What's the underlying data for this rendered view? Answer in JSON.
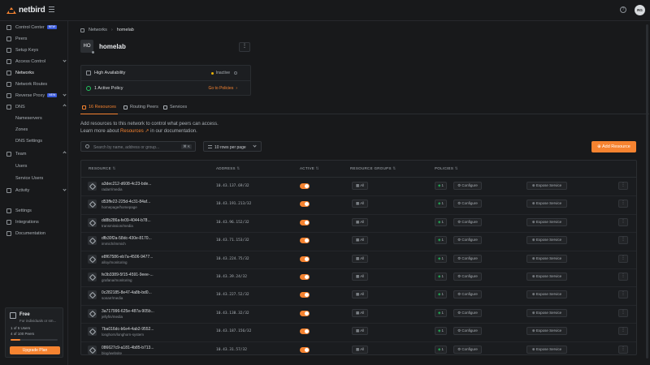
{
  "app": {
    "name": "netbird",
    "user_initials": "RG"
  },
  "sidebar": {
    "items": [
      {
        "label": "Control Center",
        "badge": "NEW",
        "icon": "grid-icon"
      },
      {
        "label": "Peers",
        "icon": "monitor-icon"
      },
      {
        "label": "Setup Keys",
        "icon": "key-icon"
      },
      {
        "label": "Access Control",
        "icon": "shield-icon"
      },
      {
        "label": "Networks",
        "icon": "network-icon"
      },
      {
        "label": "Network Routes",
        "icon": "route-icon"
      },
      {
        "label": "Reverse Proxy",
        "badge": "NEW",
        "icon": "proxy-icon"
      },
      {
        "label": "DNS",
        "icon": "globe-icon"
      },
      {
        "label": "Nameservers",
        "icon": ""
      },
      {
        "label": "Zones",
        "icon": ""
      },
      {
        "label": "DNS Settings",
        "icon": ""
      },
      {
        "label": "Team",
        "icon": "users-icon"
      },
      {
        "label": "Users",
        "icon": ""
      },
      {
        "label": "Service Users",
        "icon": ""
      },
      {
        "label": "Activity",
        "icon": "activity-icon"
      },
      {
        "label": "Settings",
        "icon": "gear-icon"
      },
      {
        "label": "Integrations",
        "icon": "puzzle-icon"
      },
      {
        "label": "Documentation",
        "icon": "book-icon"
      }
    ],
    "plan": {
      "title": "Free",
      "subtitle": "For individuals or sm...",
      "users": "1 of 5 Users",
      "peers": "4 of 100 Peers",
      "upgrade_label": "Upgrade Plan",
      "usage_fraction": 0.2
    }
  },
  "breadcrumb": {
    "root": "Networks",
    "current": "homelab"
  },
  "network": {
    "initials": "HO",
    "name": "homelab"
  },
  "info": {
    "ha_label": "High Availability",
    "ha_status": "Inactive",
    "policy_label": "1 Active Policy",
    "policy_link": "Go to Policies"
  },
  "tabs": [
    {
      "label": "16 Resources"
    },
    {
      "label": "Routing Peers"
    },
    {
      "label": "Services"
    }
  ],
  "description": {
    "line1": "Add resources to this network to control what peers can access.",
    "line2_pre": "Learn more about",
    "line2_link": "Resources",
    "line2_post": "in our documentation."
  },
  "toolbar": {
    "search_placeholder": "Search by name, address or group...",
    "search_shortcut": "⌘ K",
    "rows_per_page": "10 rows per page",
    "add_label": "Add Resource"
  },
  "table": {
    "headers": {
      "resource": "RESOURCE",
      "address": "ADDRESS",
      "active": "ACTIVE",
      "groups": "RESOURCE GROUPS",
      "policies": "POLICIES"
    },
    "group_label": "All",
    "configure_label": "Configure",
    "expose_label": "Expose Service",
    "rows": [
      {
        "id": "a3dec212-d608-4c23-bde...",
        "name": "radarr/media",
        "address": "10.43.137.69/32",
        "policies": "1"
      },
      {
        "id": "d53ffe22-225d-4c31-84af...",
        "name": "homepage/homepage",
        "address": "10.43.191.213/32",
        "policies": "1"
      },
      {
        "id": "dd8b286a-fe09-4044-b78...",
        "name": "transmission/media",
        "address": "10.43.96.152/32",
        "policies": "1"
      },
      {
        "id": "dfb30f2a-58dc-430e-8170...",
        "name": "immich/immich",
        "address": "10.43.71.153/32",
        "policies": "1"
      },
      {
        "id": "e8f67586-eb7a-4506-9477...",
        "name": "alloy/monitoring",
        "address": "10.43.224.75/32",
        "policies": "1"
      },
      {
        "id": "fe3b3389-5f15-4591-9eee-...",
        "name": "grafana/monitoring",
        "address": "10.43.39.24/32",
        "policies": "1"
      },
      {
        "id": "0c282185-8e47-4a8b-bd0...",
        "name": "sonarr/media",
        "address": "10.43.227.52/32",
        "policies": "1"
      },
      {
        "id": "3a717996-625e-487a-905b...",
        "name": "jellyfin/media",
        "address": "10.43.138.32/32",
        "policies": "1"
      },
      {
        "id": "7ba016dc-b6e4-4ab2-9552...",
        "name": "longhorn/longhorn-system",
        "address": "10.43.187.156/32",
        "policies": "1"
      },
      {
        "id": "086627c9-a181-4b85-b713...",
        "name": "blog/website",
        "address": "10.43.31.57/32",
        "policies": "1"
      }
    ]
  }
}
